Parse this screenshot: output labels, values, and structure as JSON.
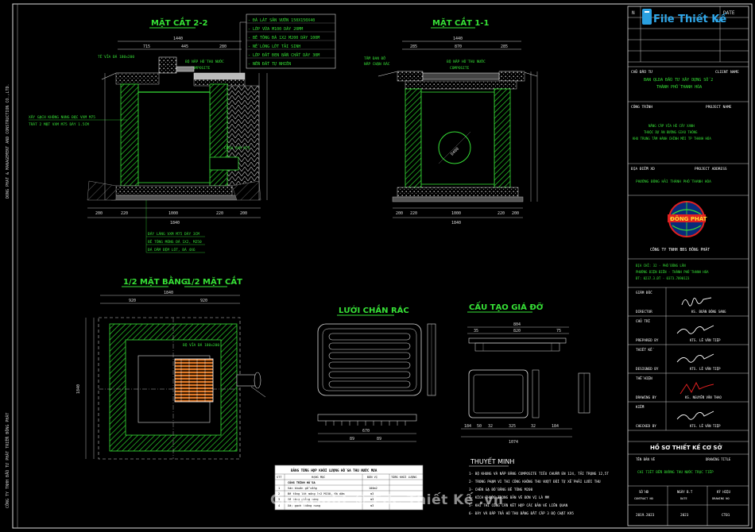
{
  "watermark": "Copyright © File Thiết Kế .vn",
  "logo_text": "File Thiết Kế",
  "logo_suffix": ".vn",
  "titles": {
    "sec22": "MẶT CẮT 2-2",
    "sec11": "MẶT CẮT 1-1",
    "plan_half": "1/2 MẶT BẰNG",
    "sec_half": "1/2 MẶT CẮT",
    "grate": "LƯỚI CHẮN RÁC",
    "frame": "CẤU TẠO GIÁ ĐỠ"
  },
  "layers": [
    "- ĐÁ LÁT SÂN VƯỜN 150X150X40",
    "- LỚP VỮA M100 DÀY 20MM",
    "- BÊ TÔNG ĐÁ 1X2 M200 DÀY 100M",
    "- NỀ LÓNG LỚT TẢI SINH",
    "- LỚP ĐẤT ĐEN BẦN CHẤT DÀY 30M",
    "- NỀN ĐẤT TỰ NHIÊN"
  ],
  "sec22_notes": {
    "paving": "TẾ VỈA ĐÁ 180x200",
    "cover": "BỘ NẮP HỐ THU NƯỚC",
    "composite": "COMPOSITE",
    "brick": "XÂY GẠCH KHÔNG NUNG ĐẶC VXM M75",
    "plaster": "TRÁT 2 MẶT VXM M75 DÀY 1.5CM",
    "pipe": "CHÈN VXM M75",
    "dim_top": "1440",
    "dims_top": [
      "715",
      "445",
      "280"
    ],
    "dims_bottom": [
      "200",
      "220",
      "1000",
      "220",
      "200"
    ],
    "dim_total": "1840"
  },
  "sec11_notes": {
    "paving": "TẤM ĐAN ĐỠ",
    "paving2": "NẮP CHẶN RÁC",
    "cover": "BỘ NẮP HỐ THU NƯỚC",
    "composite": "COMPOSITE",
    "dim_top": "1440",
    "dims_top": [
      "285",
      "870",
      "285"
    ],
    "dims_bottom": [
      "200",
      "220",
      "1000",
      "220",
      "200"
    ],
    "dim_total": "1840",
    "pipe_label": "D400"
  },
  "sec_base_notes": [
    "ĐÁY LÁNG VXM M75 DÀY 3CM",
    "BÊ TÔNG MÓNG ĐÁ 1X2, M250",
    "ĐÁ DĂM ĐỆM LÓT, ĐÁ 4X6"
  ],
  "plan_notes": {
    "grate_label": "BỘ VỈA ĐÁ 180x200",
    "dim_top": "1840",
    "dims_top": [
      "920",
      "920"
    ],
    "dim_side": "1840"
  },
  "grate_dims": [
    "670",
    "89",
    "89"
  ],
  "frame_dims": {
    "top": "804",
    "tops": [
      "35",
      "820",
      "75"
    ],
    "bottom": "1074",
    "bottoms": [
      "184",
      "50",
      "32",
      "325",
      "32",
      "184"
    ]
  },
  "table": {
    "title": "BẢNG TỔNG HỢP KHỐI LƯỢNG HỐ GA THU NƯỚC MƯA",
    "headers": [
      "STT",
      "HẠNG MỤC",
      "ĐƠN VỊ",
      "TỔNG KHỐI LƯỢNG"
    ],
    "rows": [
      [
        "",
        "CÔNG TRÌNH HỐ GA",
        "",
        ""
      ],
      [
        "1",
        "Ván khuôn gỗ cống",
        "100m2",
        ""
      ],
      [
        "2",
        "Bê tông lót móng 1x2 M150, đá dăm",
        "m3",
        ""
      ],
      [
        "3",
        "Bê tông giằng móng",
        "m3",
        ""
      ],
      [
        "4",
        "Xây gạch không nung",
        "m3",
        ""
      ]
    ]
  },
  "notes": {
    "title": "THUYẾT MINH",
    "items": [
      "1- BỘ KHUNG VÀ NẮP BẰNG COMPOSITE TIÊU CHUẨN EN 124, TẢI TRỌNG 12,5T",
      "2- TRONG PHẠM VI THI CÔNG KHÔNG THU VƯỢT ĐỔI TỰ XẾ PHẢI LƯỚI THU",
      "3- CHÈN GẠ ĐỔ BẰNG BÊ TÔNG M200",
      "4- KÍCH THƯỚC TRONG BẢN VẼ ĐƠN VỊ LÀ MM",
      "5- KHI THI CÔNG CẦN KẾT HỢP CÁC BẢN VẼ LIÊN QUAN",
      "6- ĐÁY VÀ ĐẮP TRẢ HỐ THU BẰNG ĐẤT CẤP 3 ĐỘ CHẶT K95"
    ]
  },
  "side_text_left": "DONG PHAT & MANAGEMENT AND CONSTRUCTION CO.,LTD.",
  "side_text_left2": "CÔNG TY TNHH ĐẦU TƯ PHÁT TRIỂN ĐÔNG PHÁT",
  "title_block": {
    "col_no": "N",
    "col_date": "DATE",
    "owner_label": "CHỦ ĐẦU TƯ",
    "owner_label_en": "CLIENT NAME",
    "owner": "BAN QLDA ĐẦU TƯ XÂY DỰNG SỐ 2",
    "owner2": "THÀNH PHỐ THANH HÓA",
    "project_label": "CÔNG TRÌNH",
    "project_label_en": "PROJECT NAME",
    "project": "NÂNG CẤP VỈA HÈ CÂY XANH",
    "project2": "THUỘC DỰ ÁN ĐƯỜNG GIAO THÔNG",
    "project3": "KHU TRUNG TÂM HÀNH CHÍNH MỚI TP THANH HÓA",
    "address_label": "ĐỊA ĐIỂM XD",
    "address_label_en": "PROJECT ADDRESS",
    "address": "PHƯỜNG ĐÔNG HẢI THÀNH PHỐ THANH HÓA",
    "company_logo": "ĐÔNG PHÁT",
    "company": "CÔNG TY TNHH BĐS ĐÔNG PHÁT",
    "company_addr1": "ĐỊA CHỈ: 32 - PHỐ ĐÔNG LÂN",
    "company_addr2": "PHƯỜNG ĐIỆN BIÊN - THÀNH PHỐ THANH HÓA",
    "company_addr3": "ĐT: 0237.3.ĐT - 0373.7890123",
    "roles": [
      {
        "vn": "GIÁM ĐỐC",
        "en": "DIRECTOR",
        "name": "KS. ĐOÀN ĐÔNG SANG"
      },
      {
        "vn": "CHỦ TRÌ",
        "en": "PREPARED BY",
        "name": "KTS. LÊ VĂN TIỆP"
      },
      {
        "vn": "THIẾT KẾ",
        "en": "DESIGNED BY",
        "name": "KTS. LÊ VĂN TIỆP"
      },
      {
        "vn": "THỂ HIỆN",
        "en": "DRAWING BY",
        "name": "KS. NGUYỄN VĂN THAO"
      },
      {
        "vn": "KIỂM",
        "en": "CHECKED BY",
        "name": "KTS. LÊ VĂN TIỆP"
      }
    ],
    "stage": "HỒ SƠ THIẾT KẾ CƠ SỞ",
    "drawing_label": "TÊN BẢN VẼ",
    "drawing_label_en": "DRAWING TITLE",
    "drawing": "CHI TIẾT BỂN ĐƯỜNG THU NƯỚC TRỤC TIẾP",
    "bottom_labels": [
      "SỐ HĐ",
      "NGÀY B.T",
      "KÝ HIỆU"
    ],
    "bottom_labels_en": [
      "CONTRACT NO",
      "DATE",
      "DRAWING NO"
    ],
    "bottom_values": [
      "2019.2023",
      "2023",
      "CT01"
    ]
  }
}
